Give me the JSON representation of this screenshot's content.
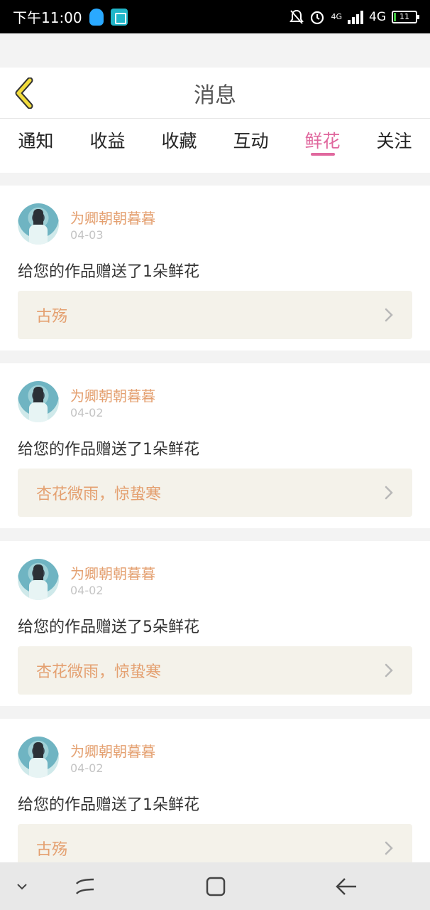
{
  "status_bar": {
    "time": "下午11:00",
    "network_label": "4G",
    "network_small": "4G",
    "battery_text": "11"
  },
  "header": {
    "title": "消息",
    "back_icon": "chevron-left-icon"
  },
  "tabs": [
    {
      "label": "通知",
      "active": false
    },
    {
      "label": "收益",
      "active": false
    },
    {
      "label": "收藏",
      "active": false
    },
    {
      "label": "互动",
      "active": false
    },
    {
      "label": "鲜花",
      "active": true
    },
    {
      "label": "关注",
      "active": false
    }
  ],
  "messages": [
    {
      "username": "为卿朝朝暮暮",
      "date": "04-03",
      "message": "给您的作品赠送了1朵鲜花",
      "work_title": "古殇"
    },
    {
      "username": "为卿朝朝暮暮",
      "date": "04-02",
      "message": "给您的作品赠送了1朵鲜花",
      "work_title": "杏花微雨，惊蛰寒"
    },
    {
      "username": "为卿朝朝暮暮",
      "date": "04-02",
      "message": "给您的作品赠送了5朵鲜花",
      "work_title": "杏花微雨，惊蛰寒"
    },
    {
      "username": "为卿朝朝暮暮",
      "date": "04-02",
      "message": "给您的作品赠送了1朵鲜花",
      "work_title": "古殇"
    }
  ],
  "colors": {
    "accent_pink": "#e0689e",
    "name_orange": "#e4a070",
    "back_yellow": "#f2dc3c"
  },
  "nav_bar": {
    "icons": [
      "chevron-down-icon",
      "recents-icon",
      "home-icon",
      "back-arrow-icon"
    ]
  }
}
